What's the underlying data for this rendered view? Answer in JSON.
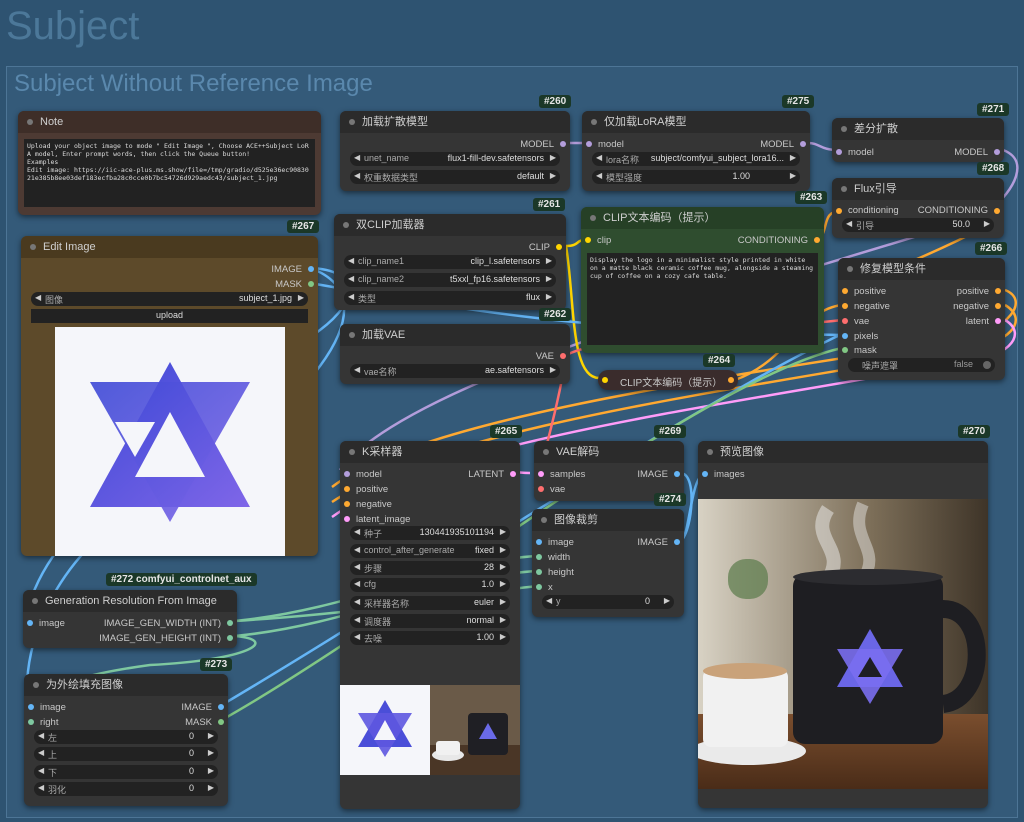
{
  "groups": {
    "outer_title": "Subject",
    "inner_title": "Subject Without Reference Image"
  },
  "colors": {
    "model": "#b39ddb",
    "clip": "#ffd500",
    "conditioning": "#ffa931",
    "vae": "#ff6e6e",
    "image": "#64b5f6",
    "mask": "#81c784",
    "latent": "#ff9cf9",
    "int": "#7ec8a0"
  },
  "nodes": {
    "note": {
      "title": "Note",
      "text": "Upload your object image to mode \" Edit Image \", Choose ACE++Subject LoRA model, Enter prompt words, then click the Queue button!\nExamples\nEdit image: https://iic-ace-plus.ms.show/file=/tmp/gradio/d525e36ec9083021e385b8ee03def183ecfba28c0cce0b7bc54726d929aedc43/subject_1.jpg"
    },
    "edit_image": {
      "badge": "#267",
      "title": "Edit Image",
      "out_image": "IMAGE",
      "out_mask": "MASK",
      "image_label": "图像",
      "image_value": "subject_1.jpg",
      "upload_label": "upload"
    },
    "unet": {
      "badge": "#260",
      "title": "加载扩散模型",
      "out": "MODEL",
      "w1_label": "unet_name",
      "w1_value": "flux1-fill-dev.safetensors",
      "w2_label": "权重数据类型",
      "w2_value": "default"
    },
    "lora": {
      "badge": "#275",
      "title": "仅加载LoRA模型",
      "in": "model",
      "out": "MODEL",
      "w1_label": "lora名称",
      "w1_value": "subject/comfyui_subject_lora16...",
      "w2_label": "模型强度",
      "w2_value": "1.00"
    },
    "diff": {
      "badge": "#271",
      "title": "差分扩散",
      "in": "model",
      "out": "MODEL"
    },
    "flux": {
      "badge": "#268",
      "title": "Flux引导",
      "in": "conditioning",
      "out": "CONDITIONING",
      "w1_label": "引导",
      "w1_value": "50.0"
    },
    "dualclip": {
      "badge": "#261",
      "title": "双CLIP加载器",
      "out": "CLIP",
      "w1_label": "clip_name1",
      "w1_value": "clip_l.safetensors",
      "w2_label": "clip_name2",
      "w2_value": "t5xxl_fp16.safetensors",
      "w3_label": "类型",
      "w3_value": "flux"
    },
    "clipenc": {
      "badge": "#263",
      "title": "CLIP文本编码（提示）",
      "in": "clip",
      "out": "CONDITIONING",
      "text": "Display the logo in a minimalist style printed in white on a matte black ceramic coffee mug, alongside a steaming cup of coffee on a cozy cafe table."
    },
    "inpaint": {
      "badge": "#266",
      "title": "修复模型条件",
      "in1": "positive",
      "in2": "negative",
      "in3": "vae",
      "in4": "pixels",
      "in5": "mask",
      "out1": "positive",
      "out2": "negative",
      "out3": "latent",
      "w1_label": "噪声遮罩",
      "w1_value": "false"
    },
    "vaeload": {
      "badge": "#262",
      "title": "加载VAE",
      "out": "VAE",
      "w1_label": "vae名称",
      "w1_value": "ae.safetensors"
    },
    "clipenc2": {
      "badge": "#264",
      "title": "CLIP文本编码（提示）"
    },
    "ksampler": {
      "badge": "#265",
      "title": "K采样器",
      "in1": "model",
      "in2": "positive",
      "in3": "negative",
      "in4": "latent_image",
      "out": "LATENT",
      "widgets": [
        {
          "label": "种子",
          "value": "130441935101194"
        },
        {
          "label": "control_after_generate",
          "value": "fixed"
        },
        {
          "label": "步骤",
          "value": "28"
        },
        {
          "label": "cfg",
          "value": "1.0"
        },
        {
          "label": "采样器名称",
          "value": "euler"
        },
        {
          "label": "调度器",
          "value": "normal"
        },
        {
          "label": "去噪",
          "value": "1.00"
        }
      ]
    },
    "vaedecode": {
      "badge": "#269",
      "title": "VAE解码",
      "in1": "samples",
      "in2": "vae",
      "out": "IMAGE"
    },
    "crop": {
      "badge": "#274",
      "title": "图像裁剪",
      "in1": "image",
      "in2": "width",
      "in3": "height",
      "in4": "x",
      "out": "IMAGE",
      "w1_label": "y",
      "w1_value": "0"
    },
    "preview": {
      "badge": "#270",
      "title": "预览图像",
      "in": "images"
    },
    "genres": {
      "badge": "#272 comfyui_controlnet_aux",
      "title": "Generation Resolution From Image",
      "in": "image",
      "out1": "IMAGE_GEN_WIDTH (INT)",
      "out2": "IMAGE_GEN_HEIGHT (INT)"
    },
    "pad": {
      "badge": "#273",
      "title": "为外绘填充图像",
      "in1": "image",
      "in2": "right",
      "out1": "IMAGE",
      "out2": "MASK",
      "widgets": [
        {
          "label": "左",
          "value": "0"
        },
        {
          "label": "上",
          "value": "0"
        },
        {
          "label": "下",
          "value": "0"
        },
        {
          "label": "羽化",
          "value": "0"
        }
      ]
    }
  }
}
